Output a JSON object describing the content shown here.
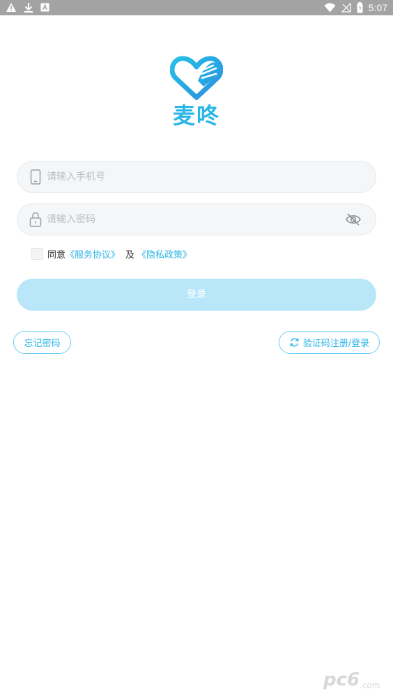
{
  "status_bar": {
    "time": "5:07",
    "left_icons": [
      "warning-icon",
      "download-icon",
      "app-notification-icon"
    ],
    "right_icons": [
      "wifi-icon",
      "no-signal-icon",
      "battery-icon"
    ]
  },
  "logo": {
    "app_name": "麦咚",
    "icon": "heart-hand-icon",
    "brand_color": "#2cb6e8"
  },
  "phone_field": {
    "icon": "phone-icon",
    "placeholder": "请输入手机号",
    "value": ""
  },
  "password_field": {
    "icon": "lock-icon",
    "placeholder": "请输入密码",
    "value": "",
    "toggle_icon": "eye-hidden-icon"
  },
  "agreement": {
    "checked": false,
    "prefix": "同意",
    "service_link": "《服务协议》",
    "and": "及",
    "privacy_link": "《隐私政策》"
  },
  "login_button": {
    "label": "登录",
    "color": "#b9e6f9"
  },
  "forgot_password": {
    "label": "忘记密码"
  },
  "sms_login": {
    "icon": "refresh-icon",
    "label": "验证码注册/登录"
  },
  "watermark": {
    "text": "pc6",
    "subtext": ".com"
  }
}
